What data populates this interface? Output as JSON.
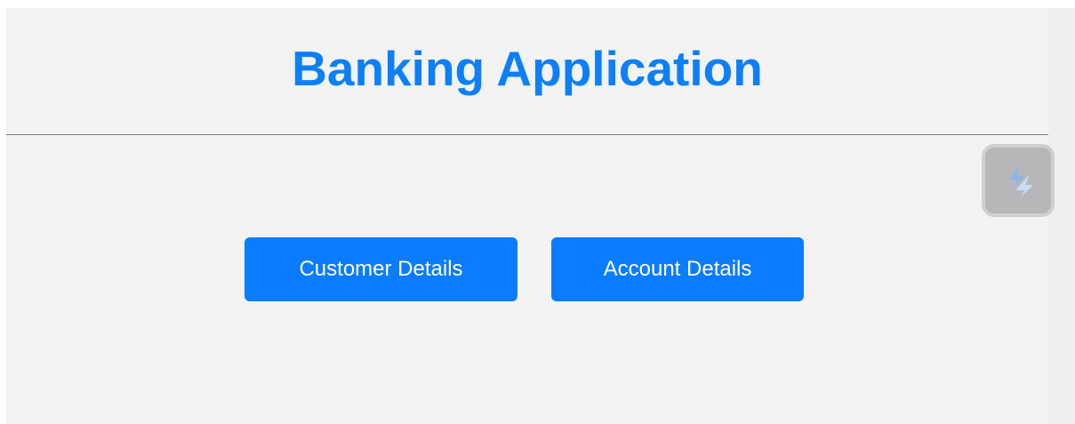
{
  "header": {
    "title": "Banking Application"
  },
  "actions": {
    "customer_label": "Customer Details",
    "account_label": "Account Details"
  },
  "colors": {
    "accent": "#0a7cff",
    "background": "#f3f3f3"
  },
  "extension": {
    "icon": "lightning-s-icon"
  }
}
